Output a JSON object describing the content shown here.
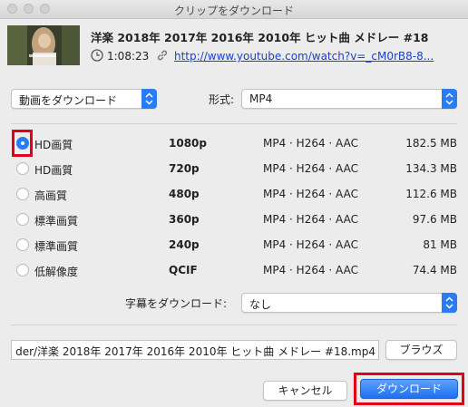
{
  "window": {
    "title": "クリップをダウンロード"
  },
  "video": {
    "title": "洋楽 2018年 2017年 2016年 2010年 ヒット曲 メドレー #18",
    "duration": "1:08:23",
    "url": "http://www.youtube.com/watch?v=_cM0rB8-8..."
  },
  "action_popup": {
    "value": "動画をダウンロード"
  },
  "format": {
    "label": "形式:",
    "value": "MP4"
  },
  "qualities": [
    {
      "quality": "HD画質",
      "resolution": "1080p",
      "codec": "MP4 · H264 · AAC",
      "size": "182.5 MB",
      "selected": true
    },
    {
      "quality": "HD画質",
      "resolution": "720p",
      "codec": "MP4 · H264 · AAC",
      "size": "134.3 MB",
      "selected": false
    },
    {
      "quality": "高画質",
      "resolution": "480p",
      "codec": "MP4 · H264 · AAC",
      "size": "112.6 MB",
      "selected": false
    },
    {
      "quality": "標準画質",
      "resolution": "360p",
      "codec": "MP4 · H264 · AAC",
      "size": "97.6 MB",
      "selected": false
    },
    {
      "quality": "標準画質",
      "resolution": "240p",
      "codec": "MP4 · H264 · AAC",
      "size": "81 MB",
      "selected": false
    },
    {
      "quality": "低解像度",
      "resolution": "QCIF",
      "codec": "MP4 · H264 · AAC",
      "size": "74.4 MB",
      "selected": false
    }
  ],
  "subtitles": {
    "label": "字幕をダウンロード:",
    "value": "なし"
  },
  "save_path": "der/洋楽 2018年 2017年 2016年 2010年 ヒット曲 メドレー #18.mp4",
  "buttons": {
    "browse": "ブラウズ",
    "cancel": "キャンセル",
    "download": "ダウンロード"
  },
  "colors": {
    "accent": "#2a7cf6",
    "highlight": "#e0001a",
    "link": "#1a3fd6"
  },
  "icons": [
    "clock-icon",
    "link-icon",
    "popup-arrows-icon"
  ]
}
